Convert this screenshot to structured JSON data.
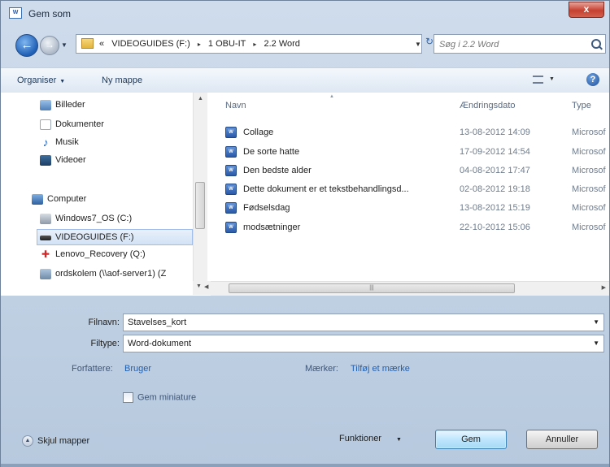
{
  "window": {
    "title": "Gem som",
    "close_symbol": "x"
  },
  "nav": {
    "back_symbol": "←",
    "forward_symbol": "→",
    "breadcrumbs": [
      "«",
      "VIDEOGUIDES (F:)",
      "▸",
      "1 OBU-IT",
      "▸",
      "2.2 Word"
    ],
    "search_placeholder": "Søg i 2.2 Word"
  },
  "toolbar": {
    "organize_label": "Organiser",
    "new_folder_label": "Ny mappe"
  },
  "sidebar": {
    "items": [
      {
        "label": "Billeder",
        "icon": "pictures-icon"
      },
      {
        "label": "Dokumenter",
        "icon": "documents-icon"
      },
      {
        "label": "Musik",
        "icon": "music-icon"
      },
      {
        "label": "Videoer",
        "icon": "videos-icon"
      },
      {
        "label": "Computer",
        "icon": "computer-icon"
      },
      {
        "label": "Windows7_OS (C:)",
        "icon": "drive-icon"
      },
      {
        "label": "VIDEOGUIDES (F:)",
        "icon": "usb-drive-icon",
        "selected": true
      },
      {
        "label": "Lenovo_Recovery (Q:)",
        "icon": "recovery-drive-icon"
      },
      {
        "label": "ordskolem (\\\\aof-server1) (Z",
        "icon": "network-drive-icon"
      }
    ]
  },
  "file_list": {
    "columns": {
      "name": "Navn",
      "date": "Ændringsdato",
      "type": "Type"
    },
    "files": [
      {
        "name": "Collage",
        "date": "13-08-2012 14:09",
        "type": "Microsof"
      },
      {
        "name": "De sorte hatte",
        "date": "17-09-2012 14:54",
        "type": "Microsof"
      },
      {
        "name": "Den bedste alder",
        "date": "04-08-2012 17:47",
        "type": "Microsof"
      },
      {
        "name": "Dette dokument er et tekstbehandlingsd...",
        "date": "02-08-2012 19:18",
        "type": "Microsof"
      },
      {
        "name": "Fødselsdag",
        "date": "13-08-2012 15:19",
        "type": "Microsof"
      },
      {
        "name": "modsætninger",
        "date": "22-10-2012 15:06",
        "type": "Microsof"
      }
    ]
  },
  "form": {
    "filename_label": "Filnavn:",
    "filename_value": "Stavelses_kort",
    "filetype_label": "Filtype:",
    "filetype_value": "Word-dokument",
    "authors_label": "Forfattere:",
    "authors_value": "Bruger",
    "tags_label": "Mærker:",
    "tags_value": "Tilføj et mærke",
    "thumbnail_label": "Gem miniature"
  },
  "footer": {
    "hide_folders_label": "Skjul mapper",
    "tools_label": "Funktioner",
    "save_label": "Gem",
    "cancel_label": "Annuller"
  }
}
